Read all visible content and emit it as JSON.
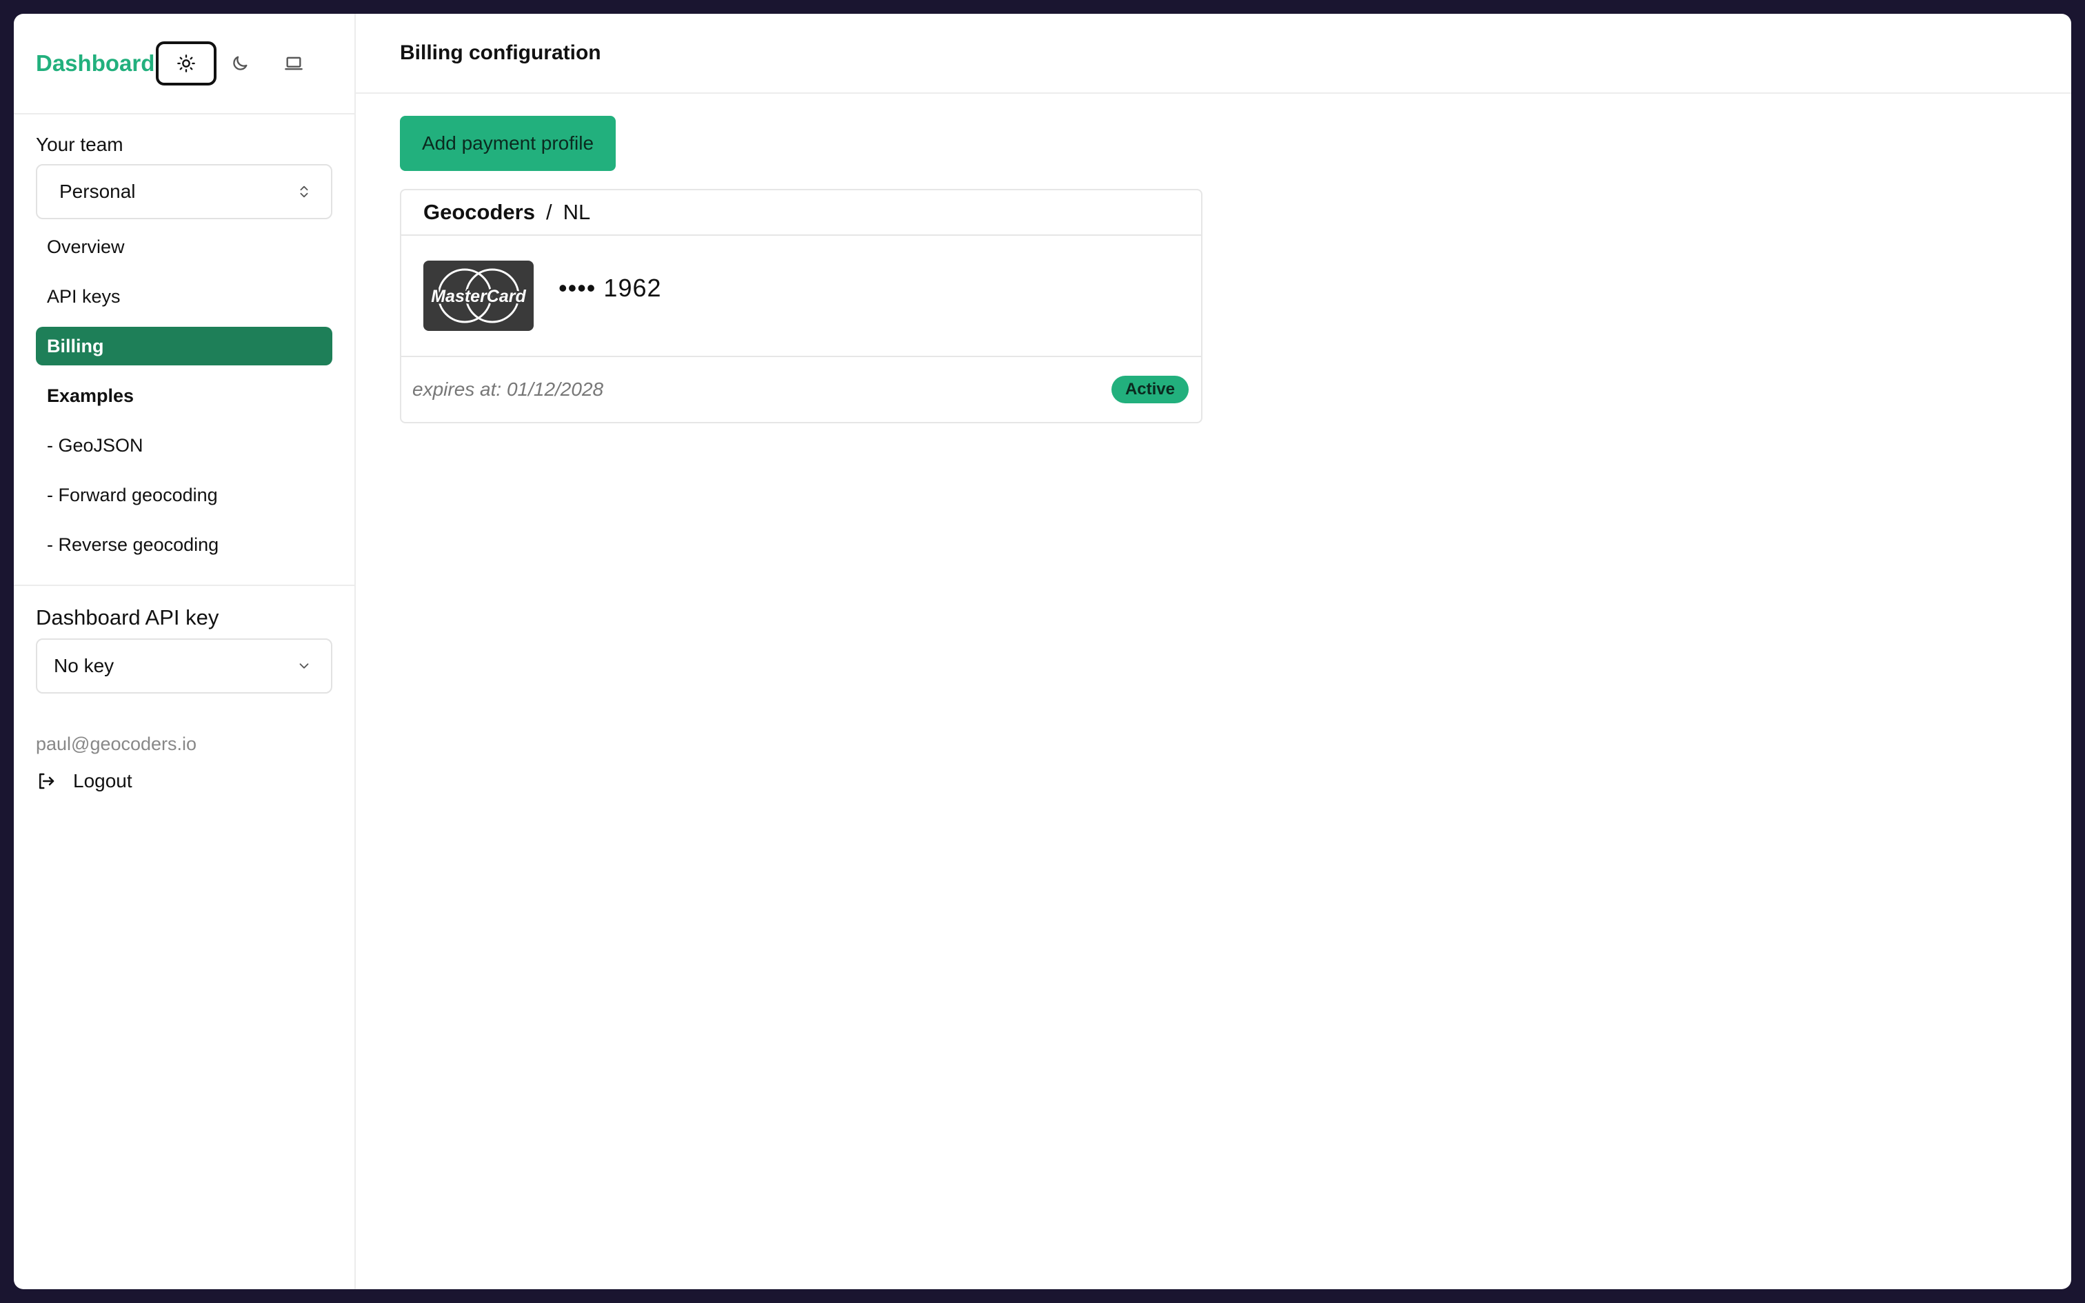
{
  "sidebar": {
    "brand": "Dashboard",
    "theme_buttons": [
      {
        "icon": "sun-icon",
        "active": true
      },
      {
        "icon": "moon-icon",
        "active": false
      },
      {
        "icon": "laptop-icon",
        "active": false
      }
    ],
    "team_label": "Your team",
    "team_select_value": "Personal",
    "nav": {
      "overview": "Overview",
      "api_keys": "API keys",
      "billing": "Billing",
      "examples": "Examples",
      "geojson": "- GeoJSON",
      "forward": "- Forward geocoding",
      "reverse": "- Reverse geocoding"
    },
    "api_key_label": "Dashboard API key",
    "api_key_value": "No key",
    "email": "paul@geocoders.io",
    "logout": "Logout"
  },
  "main": {
    "title": "Billing configuration",
    "add_button": "Add payment profile",
    "profile": {
      "org": "Geocoders",
      "separator": "/",
      "country": "NL",
      "card_brand_icon": "mastercard-logo",
      "card_number": "•••• 1962",
      "expires": "expires at: 01/12/2028",
      "status": "Active"
    }
  },
  "colors": {
    "accent": "#22b07d",
    "active_nav": "#1e7f58"
  }
}
